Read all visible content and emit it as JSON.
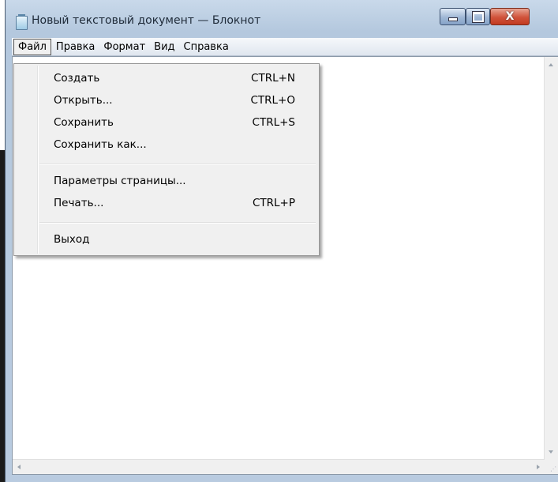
{
  "window": {
    "title": "Новый текстовый документ — Блокнот",
    "controls": {
      "minimize_icon": "minimize-icon",
      "maximize_icon": "maximize-icon",
      "close_icon": "close-icon",
      "close_glyph": "X"
    }
  },
  "menubar": {
    "items": [
      {
        "label": "Файл",
        "active": true
      },
      {
        "label": "Правка"
      },
      {
        "label": "Формат"
      },
      {
        "label": "Вид"
      },
      {
        "label": "Справка"
      }
    ]
  },
  "file_menu": {
    "items": [
      {
        "label": "Создать",
        "shortcut": "CTRL+N"
      },
      {
        "label": "Открыть...",
        "shortcut": "CTRL+O"
      },
      {
        "label": "Сохранить",
        "shortcut": "CTRL+S"
      },
      {
        "label": "Сохранить как...",
        "shortcut": ""
      },
      {
        "label": "Параметры страницы...",
        "shortcut": ""
      },
      {
        "label": "Печать...",
        "shortcut": "CTRL+P"
      },
      {
        "label": "Выход",
        "shortcut": ""
      }
    ]
  },
  "editor": {
    "text": ""
  },
  "colors": {
    "title_bar": "#c9d9ea",
    "close_button": "#d0523a",
    "menu_bg": "#f0f0f0"
  }
}
